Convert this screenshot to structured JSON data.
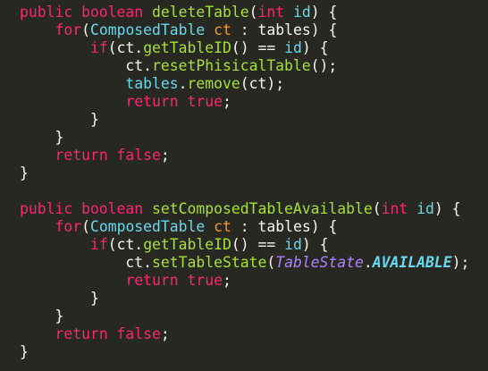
{
  "editor": {
    "theme_colors": {
      "background": "#272822",
      "keyword": "#f92672",
      "function": "#a6e22e",
      "class": "#66d9ef",
      "variable": "#fd971f",
      "plain": "#f8f8f2",
      "static_member": "#ae81ff"
    },
    "lines": [
      [
        {
          "t": "public boolean ",
          "c": "tok-keyword"
        },
        {
          "t": "deleteTable",
          "c": "tok-func"
        },
        {
          "t": "(",
          "c": "tok-plain"
        },
        {
          "t": "int",
          "c": "tok-type"
        },
        {
          "t": " ",
          "c": "tok-plain"
        },
        {
          "t": "id",
          "c": "tok-ident"
        },
        {
          "t": ") {",
          "c": "tok-plain"
        }
      ],
      [
        {
          "t": "    ",
          "c": "tok-plain"
        },
        {
          "t": "for",
          "c": "tok-keyword"
        },
        {
          "t": "(",
          "c": "tok-plain"
        },
        {
          "t": "ComposedTable",
          "c": "tok-class"
        },
        {
          "t": " ",
          "c": "tok-plain"
        },
        {
          "t": "ct",
          "c": "tok-var"
        },
        {
          "t": " : ",
          "c": "tok-plain"
        },
        {
          "t": "tables",
          "c": "tok-plain"
        },
        {
          "t": ") {",
          "c": "tok-plain"
        }
      ],
      [
        {
          "t": "        ",
          "c": "tok-plain"
        },
        {
          "t": "if",
          "c": "tok-keyword"
        },
        {
          "t": "(ct.",
          "c": "tok-plain"
        },
        {
          "t": "getTableID",
          "c": "tok-func"
        },
        {
          "t": "() == ",
          "c": "tok-plain"
        },
        {
          "t": "id",
          "c": "tok-ident"
        },
        {
          "t": ") {",
          "c": "tok-plain"
        }
      ],
      [
        {
          "t": "            ct.",
          "c": "tok-plain"
        },
        {
          "t": "resetPhisicalTable",
          "c": "tok-func"
        },
        {
          "t": "();",
          "c": "tok-plain"
        }
      ],
      [
        {
          "t": "            ",
          "c": "tok-plain"
        },
        {
          "t": "tables",
          "c": "tok-ident"
        },
        {
          "t": ".",
          "c": "tok-plain"
        },
        {
          "t": "remove",
          "c": "tok-func"
        },
        {
          "t": "(ct);",
          "c": "tok-plain"
        }
      ],
      [
        {
          "t": "            ",
          "c": "tok-plain"
        },
        {
          "t": "return true",
          "c": "tok-keyword"
        },
        {
          "t": ";",
          "c": "tok-plain"
        }
      ],
      [
        {
          "t": "        }",
          "c": "tok-plain"
        }
      ],
      [
        {
          "t": "    }",
          "c": "tok-plain"
        }
      ],
      [
        {
          "t": "    ",
          "c": "tok-plain"
        },
        {
          "t": "return false",
          "c": "tok-keyword"
        },
        {
          "t": ";",
          "c": "tok-plain"
        }
      ],
      [
        {
          "t": "}",
          "c": "tok-plain"
        }
      ],
      [
        {
          "t": "",
          "c": "tok-plain"
        }
      ],
      [
        {
          "t": "public boolean ",
          "c": "tok-keyword"
        },
        {
          "t": "setComposedTableAvailable",
          "c": "tok-func"
        },
        {
          "t": "(",
          "c": "tok-plain"
        },
        {
          "t": "int",
          "c": "tok-type"
        },
        {
          "t": " ",
          "c": "tok-plain"
        },
        {
          "t": "id",
          "c": "tok-ident"
        },
        {
          "t": ") {",
          "c": "tok-plain"
        }
      ],
      [
        {
          "t": "    ",
          "c": "tok-plain"
        },
        {
          "t": "for",
          "c": "tok-keyword"
        },
        {
          "t": "(",
          "c": "tok-plain"
        },
        {
          "t": "ComposedTable",
          "c": "tok-class"
        },
        {
          "t": " ",
          "c": "tok-plain"
        },
        {
          "t": "ct",
          "c": "tok-var"
        },
        {
          "t": " : ",
          "c": "tok-plain"
        },
        {
          "t": "tables",
          "c": "tok-plain"
        },
        {
          "t": ") {",
          "c": "tok-plain"
        }
      ],
      [
        {
          "t": "        ",
          "c": "tok-plain"
        },
        {
          "t": "if",
          "c": "tok-keyword"
        },
        {
          "t": "(ct.",
          "c": "tok-plain"
        },
        {
          "t": "getTableID",
          "c": "tok-func"
        },
        {
          "t": "() == ",
          "c": "tok-plain"
        },
        {
          "t": "id",
          "c": "tok-ident"
        },
        {
          "t": ") {",
          "c": "tok-plain"
        }
      ],
      [
        {
          "t": "            ct.",
          "c": "tok-plain"
        },
        {
          "t": "setTableState",
          "c": "tok-func"
        },
        {
          "t": "(",
          "c": "tok-plain"
        },
        {
          "t": "TableState",
          "c": "tok-italic"
        },
        {
          "t": ".",
          "c": "tok-plain"
        },
        {
          "t": "AVAILABLE",
          "c": "tok-const"
        },
        {
          "t": ");",
          "c": "tok-plain"
        }
      ],
      [
        {
          "t": "            ",
          "c": "tok-plain"
        },
        {
          "t": "return true",
          "c": "tok-keyword"
        },
        {
          "t": ";",
          "c": "tok-plain"
        }
      ],
      [
        {
          "t": "        }",
          "c": "tok-plain"
        }
      ],
      [
        {
          "t": "    }",
          "c": "tok-plain"
        }
      ],
      [
        {
          "t": "    ",
          "c": "tok-plain"
        },
        {
          "t": "return false",
          "c": "tok-keyword"
        },
        {
          "t": ";",
          "c": "tok-plain"
        }
      ],
      [
        {
          "t": "}",
          "c": "tok-plain"
        }
      ]
    ]
  }
}
